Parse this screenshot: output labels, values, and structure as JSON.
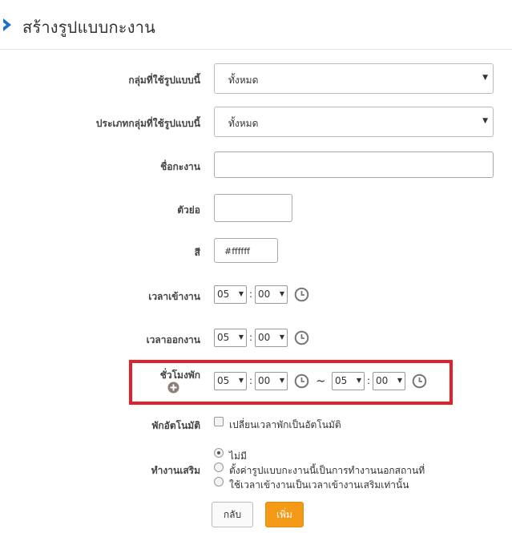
{
  "header": {
    "title": "สร้างรูปแบบกะงาน",
    "icon": "chevron-right-icon",
    "accent": "#1a73c4"
  },
  "form": {
    "group_label": "กลุ่มที่ใช้รูปแบบนี้",
    "group_value": "ทั้งหมด",
    "group_type_label": "ประเภทกลุ่มที่ใช้รูปแบบนี้",
    "group_type_value": "ทั้งหมด",
    "shift_name_label": "ชื่อกะงาน",
    "shift_name_value": "",
    "abbr_label": "ตัวย่อ",
    "abbr_value": "",
    "color_label": "สี",
    "color_value": "#ffffff",
    "time_in_label": "เวลาเข้างาน",
    "time_in_hour": "05",
    "time_in_minute": "00",
    "time_out_label": "เวลาออกงาน",
    "time_out_hour": "05",
    "time_out_minute": "00",
    "break_label": "ชั่วโมงพัก",
    "break_start_hour": "05",
    "break_start_minute": "00",
    "break_separator": "~",
    "break_end_hour": "05",
    "break_end_minute": "00",
    "auto_break_label": "พักอัตโนมัติ",
    "auto_break_option": "เปลี่ยนเวลาพักเป็นอัตโนมัติ",
    "auto_break_checked": false,
    "overtime_label": "ทำงานเสริม",
    "overtime_options": [
      "ไม่มี",
      "ตั้งค่ารูปแบบกะงานนี้เป็นการทำงานนอกสถานที่",
      "ใช้เวลาเข้างานเป็นเวลาเข้างานเสริมเท่านั้น"
    ],
    "overtime_selected": 0,
    "colon": ":",
    "caret": "▼"
  },
  "buttons": {
    "back_label": "กลับ",
    "add_label": "เพิ่ม",
    "add_color": "#f49a17"
  },
  "highlight_color": "#e3202a"
}
